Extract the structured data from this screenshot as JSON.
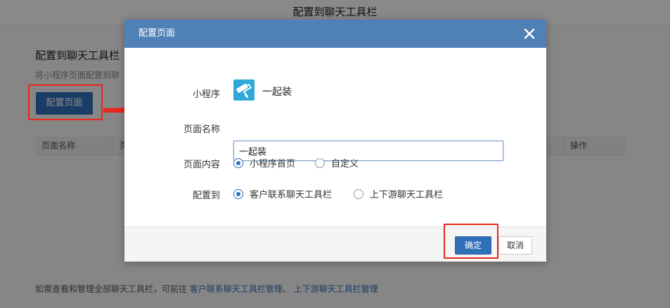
{
  "page": {
    "header_title": "配置到聊天工具栏",
    "section_title": "配置到聊天工具栏",
    "section_desc": "将小程序页面配置到聊",
    "config_button": "配置页面",
    "table_headers": [
      "页面名称",
      "页",
      "操作"
    ],
    "footer_text": "如需查看和管理全部聊天工具栏，可前往",
    "footer_link1": "客户联系聊天工具栏管理",
    "footer_sep": "、",
    "footer_link2": "上下游聊天工具栏管理"
  },
  "dialog": {
    "title": "配置页面",
    "close_icon": "close-icon",
    "mini_program_label": "小程序",
    "mini_program_name": "一起装",
    "mini_program_icon": "paint-roller-icon",
    "page_name_label": "页面名称",
    "page_name_value": "一起装",
    "page_content_label": "页面内容",
    "page_content_options": [
      "小程序首页",
      "自定义"
    ],
    "page_content_selected": "小程序首页",
    "config_to_label": "配置到",
    "config_to_options": [
      "客户联系聊天工具栏",
      "上下游聊天工具栏"
    ],
    "config_to_selected": "客户联系聊天工具栏",
    "confirm_button": "确定",
    "cancel_button": "取消"
  },
  "colors": {
    "accent": "#2f6fb8",
    "dialog_header": "#4f80b6",
    "highlight": "#e8271c",
    "app_icon": "#2fa9d9"
  }
}
